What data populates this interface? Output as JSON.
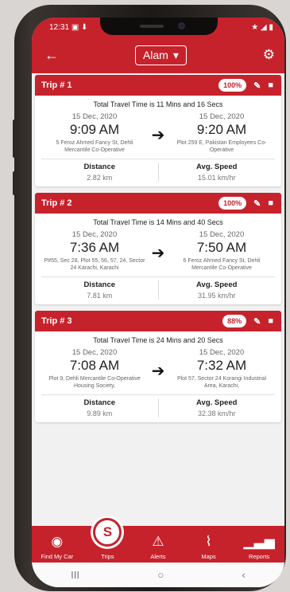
{
  "status_bar": {
    "time": "12:31",
    "left_icons": "▣ ⬇",
    "right_icons": "★ ◢ ▮"
  },
  "app_bar": {
    "back_icon": "←",
    "user_name": "Alam",
    "dropdown_icon": "▾",
    "settings_icon": "⚙"
  },
  "trips": [
    {
      "title": "Trip # 1",
      "score": "100%",
      "travel_time": "Total Travel Time is 11 Mins and 16 Secs",
      "start": {
        "date": "15 Dec, 2020",
        "time": "9:09 AM",
        "address": "5 Feroz Ahmed Fancy St, Dehli Mercantile Co-Operative"
      },
      "end": {
        "date": "15 Dec, 2020",
        "time": "9:20 AM",
        "address": "Plot 259 E, Pakistan Employees Co-Operative"
      },
      "distance_label": "Distance",
      "distance": "2.82 km",
      "speed_label": "Avg. Speed",
      "speed": "15.01 km/hr"
    },
    {
      "title": "Trip # 2",
      "score": "100%",
      "travel_time": "Total Travel Time is 14 Mins and 40 Secs",
      "start": {
        "date": "15 Dec, 2020",
        "time": "7:36 AM",
        "address": "P#55, Sec 28, Plot 55, 56, 57, 24, Sector 24 Karachi, Karachi"
      },
      "end": {
        "date": "15 Dec, 2020",
        "time": "7:50 AM",
        "address": "6 Feroz Ahmed Fancy St, Dehli Mercantile Co-Operative"
      },
      "distance_label": "Distance",
      "distance": "7.81 km",
      "speed_label": "Avg. Speed",
      "speed": "31.95 km/hr"
    },
    {
      "title": "Trip # 3",
      "score": "88%",
      "travel_time": "Total Travel Time is 24 Mins and 20 Secs",
      "start": {
        "date": "15 Dec, 2020",
        "time": "7:08 AM",
        "address": "Plot 9, Dehli Mercantile Co-Operative Housing Society,"
      },
      "end": {
        "date": "15 Dec, 2020",
        "time": "7:32 AM",
        "address": "Plot 57, Sector 24 Korangi Industrial Area, Karachi,"
      },
      "distance_label": "Distance",
      "distance": "9.89 km",
      "speed_label": "Avg. Speed",
      "speed": "32.38 km/hr"
    }
  ],
  "bottom_nav": [
    {
      "label": "Find My Car",
      "icon": "◉"
    },
    {
      "label": "Trips",
      "icon": "S",
      "active": true
    },
    {
      "label": "Alerts",
      "icon": "⚠"
    },
    {
      "label": "Maps",
      "icon": "⌇"
    },
    {
      "label": "Reports",
      "icon": "▁▃▅"
    }
  ],
  "system_nav": {
    "recents": "III",
    "home": "○",
    "back": "‹"
  },
  "colors": {
    "brand_red": "#c6222c"
  }
}
